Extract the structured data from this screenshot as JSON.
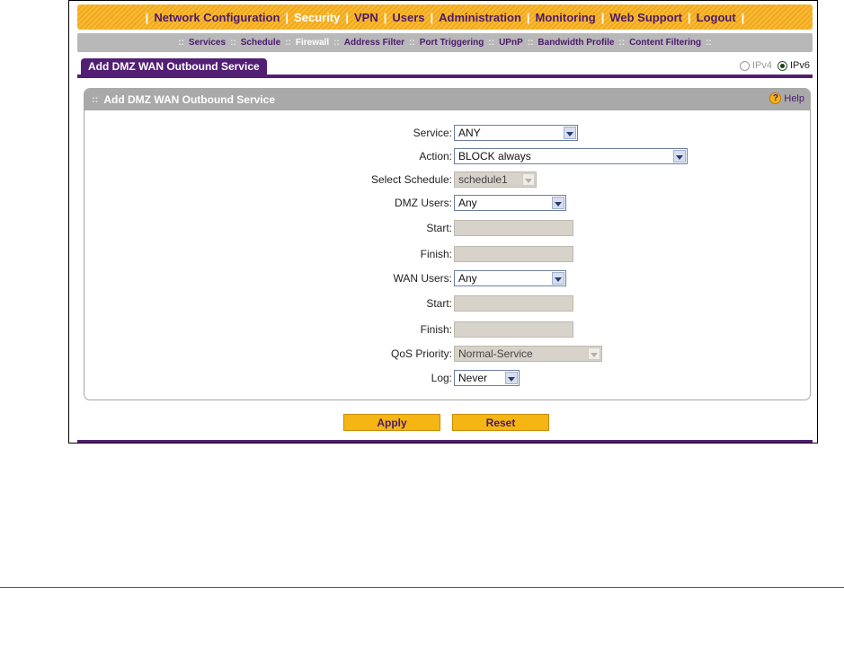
{
  "top_nav": {
    "items": [
      {
        "label": "Network Configuration"
      },
      {
        "label": "Security"
      },
      {
        "label": "VPN"
      },
      {
        "label": "Users"
      },
      {
        "label": "Administration"
      },
      {
        "label": "Monitoring"
      },
      {
        "label": "Web Support"
      },
      {
        "label": "Logout"
      }
    ],
    "active": "Security",
    "separator": "|"
  },
  "sub_nav": {
    "items": [
      {
        "label": "Services"
      },
      {
        "label": "Schedule"
      },
      {
        "label": "Firewall"
      },
      {
        "label": "Address Filter"
      },
      {
        "label": "Port Triggering"
      },
      {
        "label": "UPnP"
      },
      {
        "label": "Bandwidth Profile"
      },
      {
        "label": "Content Filtering"
      }
    ],
    "active": "Firewall",
    "separator": "::"
  },
  "tab": {
    "label": "Add DMZ WAN Outbound Service"
  },
  "ip_version": {
    "ipv4_label": "IPv4",
    "ipv6_label": "IPv6",
    "selected": "IPv6"
  },
  "panel": {
    "title": "Add DMZ WAN Outbound Service",
    "grip": "::",
    "help_label": "Help",
    "help_glyph": "?"
  },
  "form": {
    "service": {
      "label": "Service:",
      "value": "ANY"
    },
    "action": {
      "label": "Action:",
      "value": "BLOCK always"
    },
    "schedule": {
      "label": "Select Schedule:",
      "value": "schedule1"
    },
    "dmz_users": {
      "label": "DMZ Users:",
      "value": "Any"
    },
    "dmz_start": {
      "label": "Start:",
      "value": ""
    },
    "dmz_finish": {
      "label": "Finish:",
      "value": ""
    },
    "wan_users": {
      "label": "WAN Users:",
      "value": "Any"
    },
    "wan_start": {
      "label": "Start:",
      "value": ""
    },
    "wan_finish": {
      "label": "Finish:",
      "value": ""
    },
    "qos": {
      "label": "QoS Priority:",
      "value": "Normal-Service"
    },
    "log": {
      "label": "Log:",
      "value": "Never"
    }
  },
  "buttons": {
    "apply": "Apply",
    "reset": "Reset"
  },
  "colors": {
    "brand_purple": "#521f74",
    "nav_orange": "#f5b513",
    "subnav_gray": "#b8b8b8"
  }
}
